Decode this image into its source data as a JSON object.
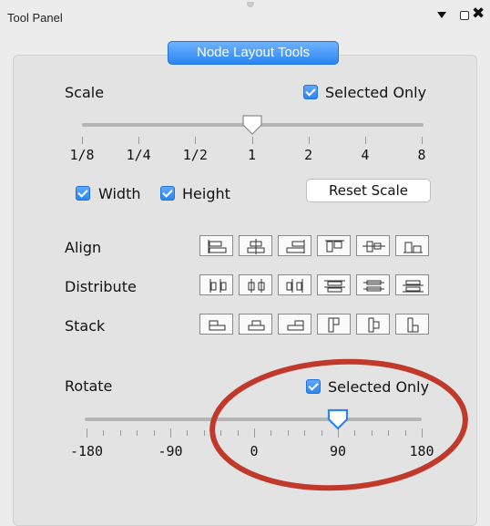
{
  "window": {
    "title": "Tool Panel"
  },
  "panel": {
    "tab_label": "Node Layout Tools"
  },
  "scale": {
    "label": "Scale",
    "selected_only_label": "Selected Only",
    "selected_only_checked": true,
    "tick_labels": [
      "1/8",
      "1/4",
      "1/2",
      "1",
      "2",
      "4",
      "8"
    ],
    "value": "1",
    "width_label": "Width",
    "width_checked": true,
    "height_label": "Height",
    "height_checked": true,
    "reset_label": "Reset Scale"
  },
  "align": {
    "label": "Align",
    "icons": [
      "align-left-icon",
      "align-center-icon",
      "align-right-icon",
      "align-top-icon",
      "align-middle-icon",
      "align-bottom-icon"
    ]
  },
  "distribute": {
    "label": "Distribute",
    "icons": [
      "distribute-left-icon",
      "distribute-center-icon",
      "distribute-right-icon",
      "distribute-top-icon",
      "distribute-middle-icon",
      "distribute-bottom-icon"
    ]
  },
  "stack": {
    "label": "Stack",
    "icons": [
      "stack-left-icon",
      "stack-center-icon",
      "stack-right-icon",
      "stack-top-icon",
      "stack-middle-icon",
      "stack-bottom-icon"
    ]
  },
  "rotate": {
    "label": "Rotate",
    "selected_only_label": "Selected Only",
    "selected_only_checked": true,
    "tick_labels": [
      "-180",
      "-90",
      "0",
      "90",
      "180"
    ],
    "min": -180,
    "max": 180,
    "value": 90
  },
  "colors": {
    "accent": "#2b86f3",
    "annotation": "#c0392b"
  }
}
